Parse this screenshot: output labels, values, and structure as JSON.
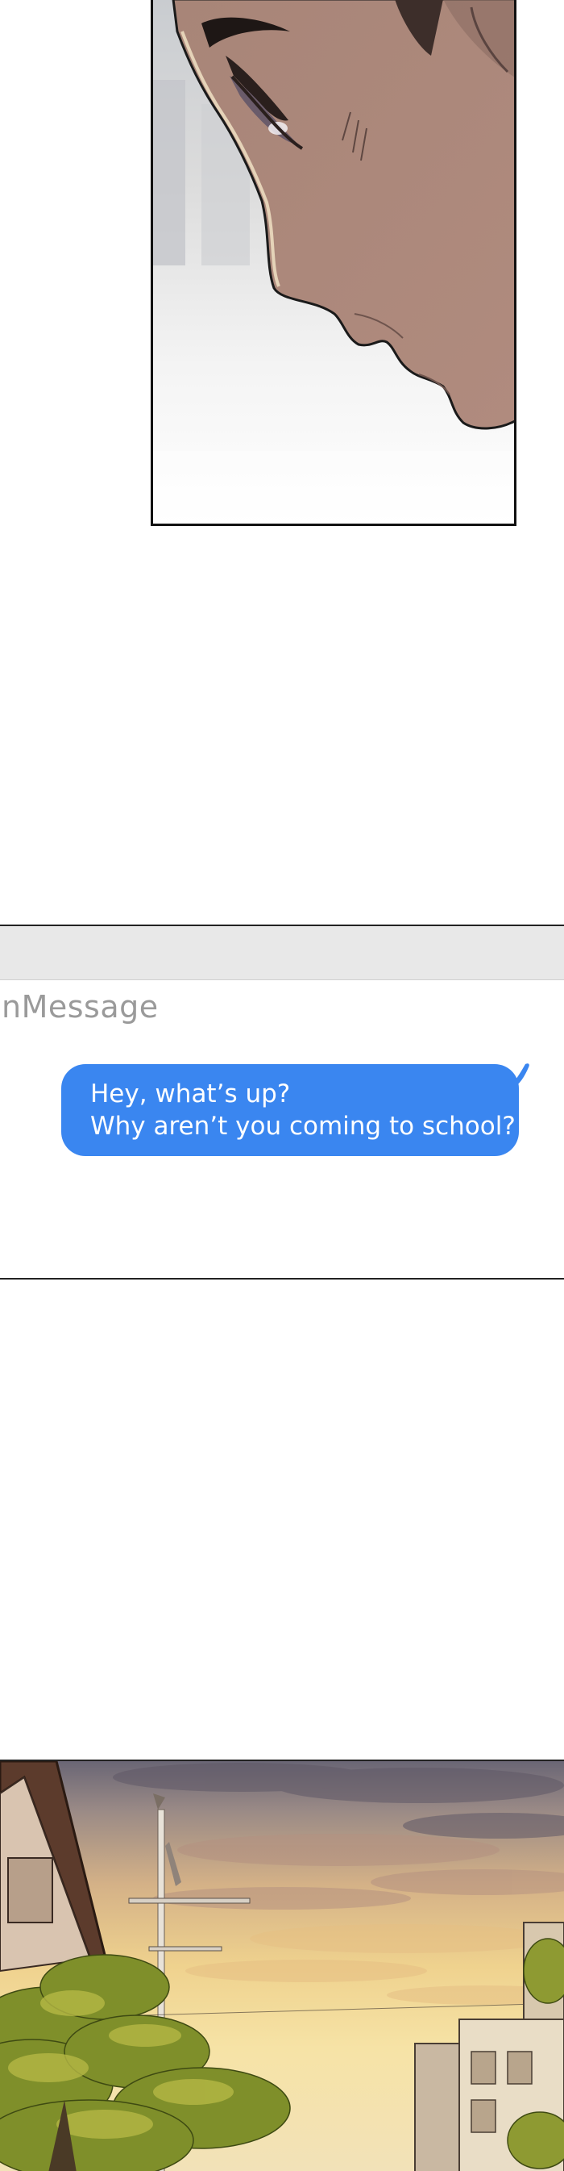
{
  "phone": {
    "app_name": "nMessage",
    "message": {
      "line1": "Hey, what’s up?",
      "line2": "Why aren’t you coming to school?"
    },
    "bubble_color": "#3a86f0",
    "topbar_color": "#e8e8e8"
  },
  "panels": {
    "face": {
      "illustration": "face-closeup"
    },
    "town": {
      "illustration": "sunset-town"
    }
  }
}
